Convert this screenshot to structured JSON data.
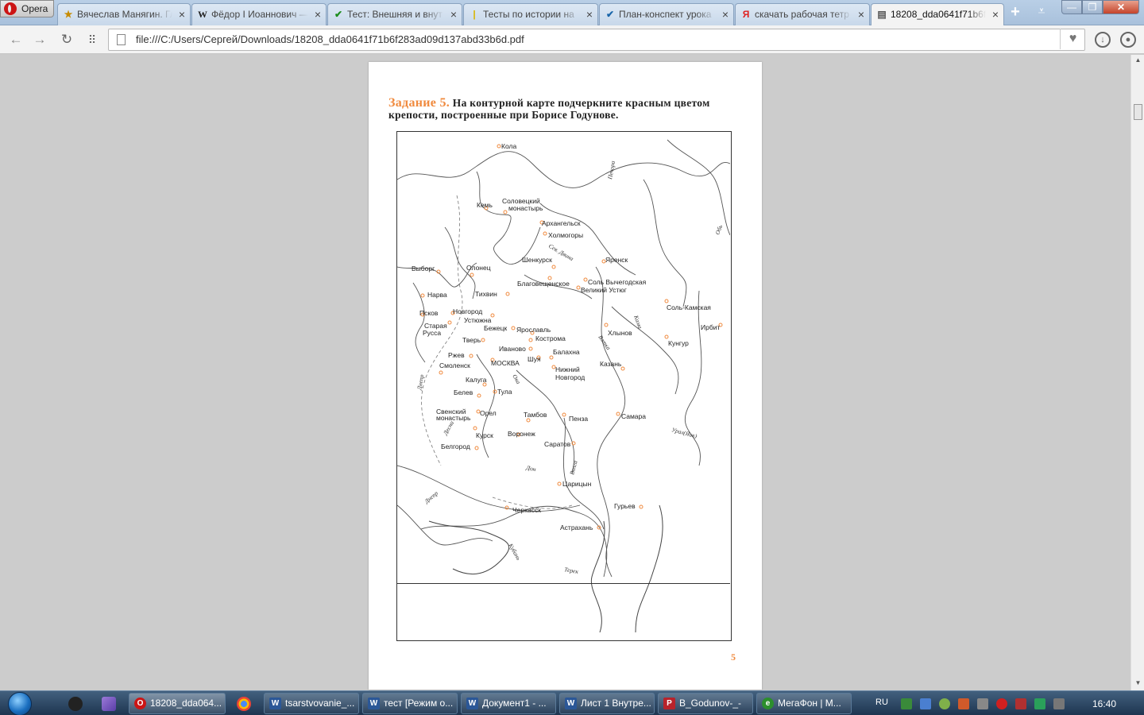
{
  "browser": {
    "menu_label": "Opera",
    "tabs": [
      {
        "label": "Вячеслав Манягин. Гл",
        "icon": "★"
      },
      {
        "label": "Фёдор I Иоаннович —",
        "icon": "W"
      },
      {
        "label": "Тест: Внешняя и внут",
        "icon": "✔"
      },
      {
        "label": "Тесты по истории на",
        "icon": "|"
      },
      {
        "label": "План-конспект урока",
        "icon": "✔"
      },
      {
        "label": "скачать рабочая тетр",
        "icon": "Я"
      },
      {
        "label": "18208_dda0641f71b6f",
        "icon": "▤"
      }
    ],
    "address": "file:///C:/Users/Сергей/Downloads/18208_dda0641f71b6f283ad09d137abd33b6d.pdf"
  },
  "document": {
    "task_number": "Задание 5.",
    "task_text": "На контурной карте подчеркните красным цветом крепости, построенные при Борисе Годунове.",
    "page_number": "5",
    "cities": [
      "Кола",
      "Соловецкий",
      "монастырь",
      "Кемь",
      "Архангельск",
      "Холмогоры",
      "Шенкурск",
      "Яренск",
      "Выборг",
      "Олонец",
      "Благовещенское",
      "Соль Вычегодская",
      "Великий Устюг",
      "Нарва",
      "Тихвин",
      "Соль-Камская",
      "Псков",
      "Новгород",
      "Устюжна",
      "Старая",
      "Русса",
      "Бежецк",
      "Ярославль",
      "Хлынов",
      "Ирбит",
      "Тверь",
      "Кострома",
      "Кунгур",
      "Иваново",
      "Ржев",
      "Балахна",
      "Шуя",
      "МОСКВА",
      "Смоленск",
      "Нижний",
      "Новгород",
      "Казань",
      "Калуга",
      "Тула",
      "Белев",
      "Свенский",
      "монастырь",
      "Орел",
      "Тамбов",
      "Пенза",
      "Самара",
      "Курск",
      "Воронеж",
      "Белгород",
      "Саратов",
      "Царицын",
      "Черкасск",
      "Гурьев",
      "Астрахань"
    ],
    "rivers": [
      "Печора",
      "Обь",
      "Сев. Двина",
      "Вятка",
      "Кама",
      "Урал(Яик)",
      "Днепр",
      "Десна",
      "Ока",
      "Волга",
      "Дон",
      "Кубань",
      "Терек",
      "Днепр"
    ]
  },
  "taskbar": {
    "items": [
      "18208_dda064...",
      "tsarstvovanie_...",
      "тест [Режим о...",
      "Документ1 - ...",
      "Лист 1 Внутре...",
      "B_Godunov-_-",
      "МегаФон | М..."
    ],
    "lang": "RU",
    "clock": "16:40"
  }
}
